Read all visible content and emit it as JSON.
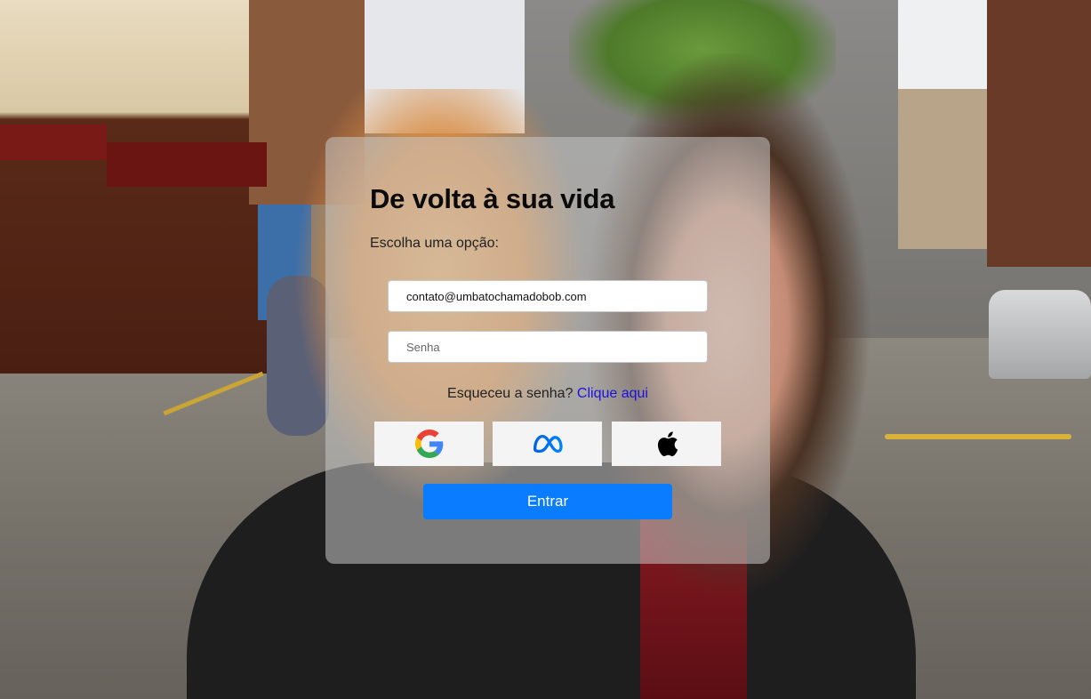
{
  "login": {
    "title": "De volta à sua vida",
    "subtitle": "Escolha uma opção:",
    "email_value": "contato@umbatochamadobob.com",
    "password_placeholder": "Senha",
    "forgot_text": "Esqueceu a senha?",
    "forgot_link": "Clique aqui",
    "submit_label": "Entrar"
  },
  "social_logins": [
    {
      "name": "Google",
      "icon": "google-icon"
    },
    {
      "name": "Meta",
      "icon": "meta-icon"
    },
    {
      "name": "Apple",
      "icon": "apple-icon"
    }
  ],
  "colors": {
    "primary_button": "#0a7cff",
    "link": "#1a10e0",
    "card_overlay": "rgba(200,200,200,0.55)"
  }
}
